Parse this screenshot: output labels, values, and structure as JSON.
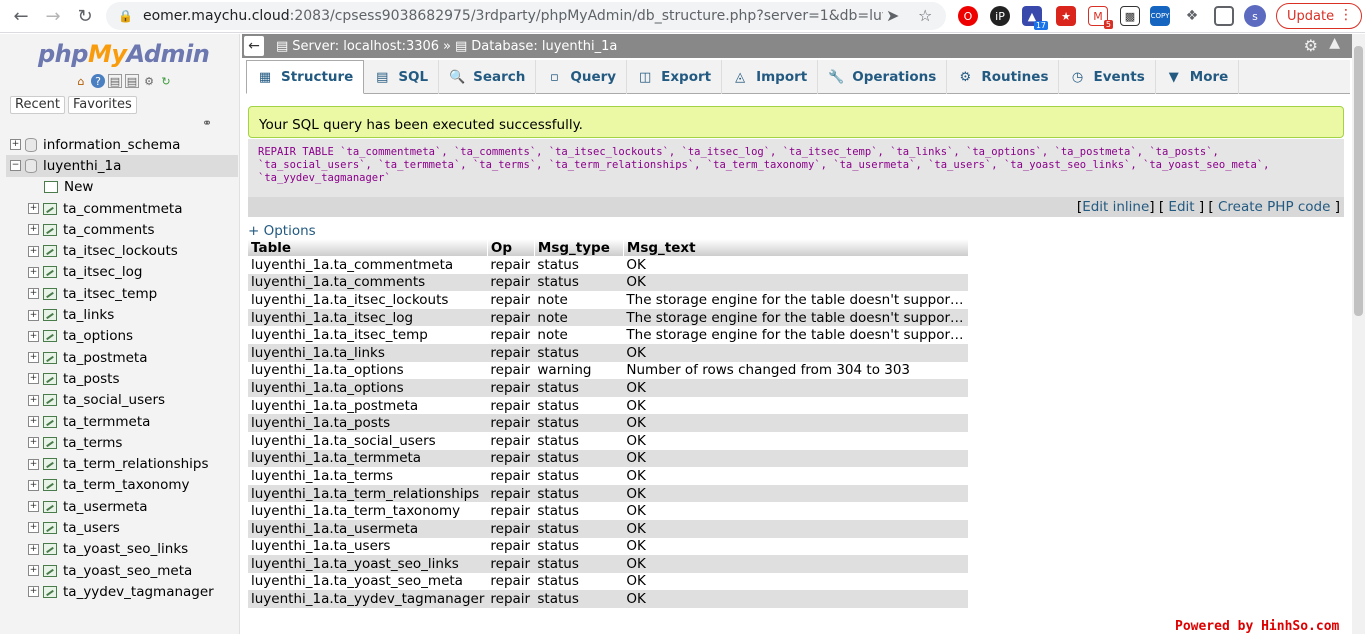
{
  "browser": {
    "url_host": "eomer.maychu.cloud",
    "url_rest": ":2083/cpsess9038682975/3rdparty/phpMyAdmin/db_structure.php?server=1&db=luye...",
    "avatar_letter": "s",
    "update_label": "Update",
    "ext_badges": {
      "ext3": "17",
      "ext5": "5",
      "ext7": "COPY"
    }
  },
  "logo": {
    "php": "php",
    "my": "My",
    "admin": "Admin"
  },
  "nav": {
    "recent_label": "Recent",
    "favorites_label": "Favorites",
    "databases": [
      {
        "name": "information_schema"
      },
      {
        "name": "luyenthi_1a"
      }
    ],
    "new_label": "New",
    "tables": [
      "ta_commentmeta",
      "ta_comments",
      "ta_itsec_lockouts",
      "ta_itsec_log",
      "ta_itsec_temp",
      "ta_links",
      "ta_options",
      "ta_postmeta",
      "ta_posts",
      "ta_social_users",
      "ta_termmeta",
      "ta_terms",
      "ta_term_relationships",
      "ta_term_taxonomy",
      "ta_usermeta",
      "ta_users",
      "ta_yoast_seo_links",
      "ta_yoast_seo_meta",
      "ta_yydev_tagmanager"
    ]
  },
  "breadcrumb": {
    "server": "Server: localhost:3306",
    "sep": "»",
    "database": "Database: luyenthi_1a"
  },
  "tabs": [
    {
      "label": "Structure",
      "icon": "structure-icon"
    },
    {
      "label": "SQL",
      "icon": "sql-icon"
    },
    {
      "label": "Search",
      "icon": "search-icon"
    },
    {
      "label": "Query",
      "icon": "query-icon"
    },
    {
      "label": "Export",
      "icon": "export-icon"
    },
    {
      "label": "Import",
      "icon": "import-icon"
    },
    {
      "label": "Operations",
      "icon": "operations-icon"
    },
    {
      "label": "Routines",
      "icon": "routines-icon"
    },
    {
      "label": "Events",
      "icon": "events-icon"
    },
    {
      "label": "More",
      "icon": "more-icon"
    }
  ],
  "message": {
    "success": "Your SQL query has been executed successfully.",
    "sql_line1": "REPAIR TABLE `ta_commentmeta`, `ta_comments`, `ta_itsec_lockouts`, `ta_itsec_log`, `ta_itsec_temp`, `ta_links`, `ta_options`, `ta_postmeta`, `ta_posts`,",
    "sql_line2": "`ta_social_users`, `ta_termmeta`, `ta_terms`, `ta_term_relationships`, `ta_term_taxonomy`, `ta_usermeta`, `ta_users`, `ta_yoast_seo_links`, `ta_yoast_seo_meta`,",
    "sql_line3": "`ta_yydev_tagmanager`",
    "edit_inline": "Edit inline",
    "edit": "Edit",
    "create_php": "Create PHP code"
  },
  "options_label": "+ Options",
  "results": {
    "headers": [
      "Table",
      "Op",
      "Msg_type",
      "Msg_text"
    ],
    "rows": [
      [
        "luyenthi_1a.ta_commentmeta",
        "repair",
        "status",
        "OK"
      ],
      [
        "luyenthi_1a.ta_comments",
        "repair",
        "status",
        "OK"
      ],
      [
        "luyenthi_1a.ta_itsec_lockouts",
        "repair",
        "note",
        "The storage engine for the table doesn't support r..."
      ],
      [
        "luyenthi_1a.ta_itsec_log",
        "repair",
        "note",
        "The storage engine for the table doesn't support r..."
      ],
      [
        "luyenthi_1a.ta_itsec_temp",
        "repair",
        "note",
        "The storage engine for the table doesn't support r..."
      ],
      [
        "luyenthi_1a.ta_links",
        "repair",
        "status",
        "OK"
      ],
      [
        "luyenthi_1a.ta_options",
        "repair",
        "warning",
        "Number of rows changed from 304 to 303"
      ],
      [
        "luyenthi_1a.ta_options",
        "repair",
        "status",
        "OK"
      ],
      [
        "luyenthi_1a.ta_postmeta",
        "repair",
        "status",
        "OK"
      ],
      [
        "luyenthi_1a.ta_posts",
        "repair",
        "status",
        "OK"
      ],
      [
        "luyenthi_1a.ta_social_users",
        "repair",
        "status",
        "OK"
      ],
      [
        "luyenthi_1a.ta_termmeta",
        "repair",
        "status",
        "OK"
      ],
      [
        "luyenthi_1a.ta_terms",
        "repair",
        "status",
        "OK"
      ],
      [
        "luyenthi_1a.ta_term_relationships",
        "repair",
        "status",
        "OK"
      ],
      [
        "luyenthi_1a.ta_term_taxonomy",
        "repair",
        "status",
        "OK"
      ],
      [
        "luyenthi_1a.ta_usermeta",
        "repair",
        "status",
        "OK"
      ],
      [
        "luyenthi_1a.ta_users",
        "repair",
        "status",
        "OK"
      ],
      [
        "luyenthi_1a.ta_yoast_seo_links",
        "repair",
        "status",
        "OK"
      ],
      [
        "luyenthi_1a.ta_yoast_seo_meta",
        "repair",
        "status",
        "OK"
      ],
      [
        "luyenthi_1a.ta_yydev_tagmanager",
        "repair",
        "status",
        "OK"
      ]
    ]
  },
  "watermark": "Powered by HinhSo.com",
  "colors": {
    "accent": "#235a81",
    "success_bg": "#ebf8a4",
    "topbar": "#888888"
  }
}
